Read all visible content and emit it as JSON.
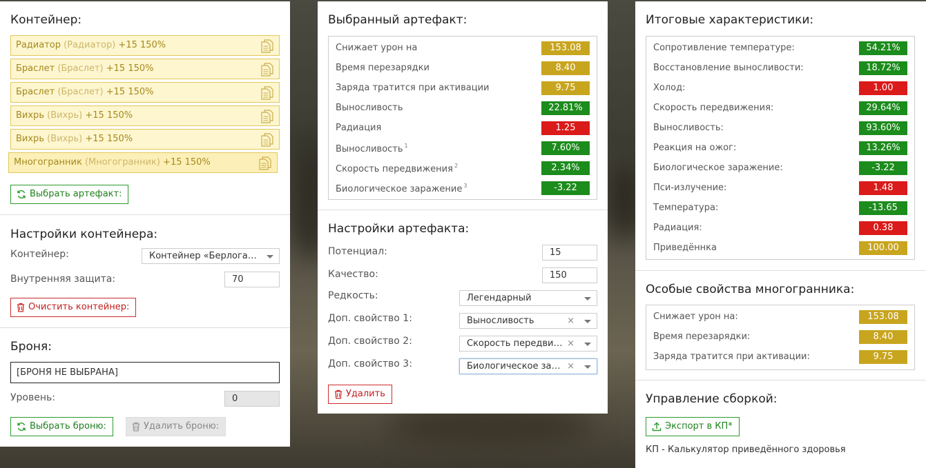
{
  "colors": {
    "green": "#1c8c1c",
    "red": "#db1a1a",
    "gold": "#c8a51e"
  },
  "left": {
    "container_title": "Контейнер:",
    "slots": [
      {
        "name": "Радиатор",
        "sub": "(Радиатор)",
        "bonus": "+15 150%"
      },
      {
        "name": "Браслет",
        "sub": "(Браслет)",
        "bonus": "+15 150%"
      },
      {
        "name": "Браслет",
        "sub": "(Браслет)",
        "bonus": "+15 150%"
      },
      {
        "name": "Вихрь",
        "sub": "(Вихрь)",
        "bonus": "+15 150%"
      },
      {
        "name": "Вихрь",
        "sub": "(Вихрь)",
        "bonus": "+15 150%"
      },
      {
        "name": "Многогранник",
        "sub": "(Многогранник)",
        "bonus": "+15 150%"
      }
    ],
    "choose_artifact_button": "Выбрать артефакт:",
    "container_settings_title": "Настройки контейнера:",
    "container_label": "Контейнер:",
    "container_value": "Контейнер «Берлога…",
    "inner_protection_label": "Внутренняя защита:",
    "inner_protection_value": "70",
    "clear_container_button": "Очистить контейнер:",
    "armor_title": "Броня:",
    "armor_value": "[БРОНЯ НЕ ВЫБРАНА]",
    "level_label": "Уровень:",
    "level_value": "0",
    "choose_armor_button": "Выбрать броню:",
    "delete_armor_button": "Удалить броню:"
  },
  "middle": {
    "selected_title": "Выбранный артефакт:",
    "stats": [
      {
        "label": "Снижает урон на",
        "sup": "",
        "value": "153.08",
        "color": "gold"
      },
      {
        "label": "Время перезарядки",
        "sup": "",
        "value": "8.40",
        "color": "gold"
      },
      {
        "label": "Заряда тратится при активации",
        "sup": "",
        "value": "9.75",
        "color": "gold"
      },
      {
        "label": "Выносливость",
        "sup": "",
        "value": "22.81%",
        "color": "green"
      },
      {
        "label": "Радиация",
        "sup": "",
        "value": "1.25",
        "color": "red"
      },
      {
        "label": "Выносливость",
        "sup": "1",
        "value": "7.60%",
        "color": "green"
      },
      {
        "label": "Скорость передвижения",
        "sup": "2",
        "value": "2.34%",
        "color": "green"
      },
      {
        "label": "Биологическое заражение",
        "sup": "3",
        "value": "-3.22",
        "color": "green"
      }
    ],
    "settings_title": "Настройки артефакта:",
    "potential_label": "Потенциал:",
    "potential_value": "15",
    "quality_label": "Качество:",
    "quality_value": "150",
    "rarity_label": "Редкость:",
    "rarity_value": "Легендарный",
    "extra1_label": "Доп. свойство 1:",
    "extra1_value": "Выносливость",
    "extra2_label": "Доп. свойство 2:",
    "extra2_value": "Скорость передви…",
    "extra3_label": "Доп. свойство 3:",
    "extra3_value": "Биологическое за…",
    "clear_mark": "×",
    "delete_button": "Удалить"
  },
  "right": {
    "totals_title": "Итоговые характеристики:",
    "totals": [
      {
        "label": "Сопротивление температуре:",
        "value": "54.21%",
        "color": "green"
      },
      {
        "label": "Восстановление выносливости:",
        "value": "18.72%",
        "color": "green"
      },
      {
        "label": "Холод:",
        "value": "1.00",
        "color": "red"
      },
      {
        "label": "Скорость передвижения:",
        "value": "29.64%",
        "color": "green"
      },
      {
        "label": "Выносливость:",
        "value": "93.60%",
        "color": "green"
      },
      {
        "label": "Реакция на ожог:",
        "value": "13.26%",
        "color": "green"
      },
      {
        "label": "Биологическое заражение:",
        "value": "-3.22",
        "color": "green"
      },
      {
        "label": "Пси-излучение:",
        "value": "1.48",
        "color": "red"
      },
      {
        "label": "Температура:",
        "value": "-13.65",
        "color": "green"
      },
      {
        "label": "Радиация:",
        "value": "0.38",
        "color": "red"
      },
      {
        "label": "Приведённка",
        "value": "100.00",
        "color": "gold"
      }
    ],
    "special_title": "Особые свойства многогранника:",
    "special": [
      {
        "label": "Снижает урон на:",
        "value": "153.08",
        "color": "gold"
      },
      {
        "label": "Время перезарядки:",
        "value": "8.40",
        "color": "gold"
      },
      {
        "label": "Заряда тратится при активации:",
        "value": "9.75",
        "color": "gold"
      }
    ],
    "build_title": "Управление сборкой:",
    "export_button": "Экспорт в КП*",
    "footnote": "КП - Калькулятор приведённого здоровья"
  }
}
